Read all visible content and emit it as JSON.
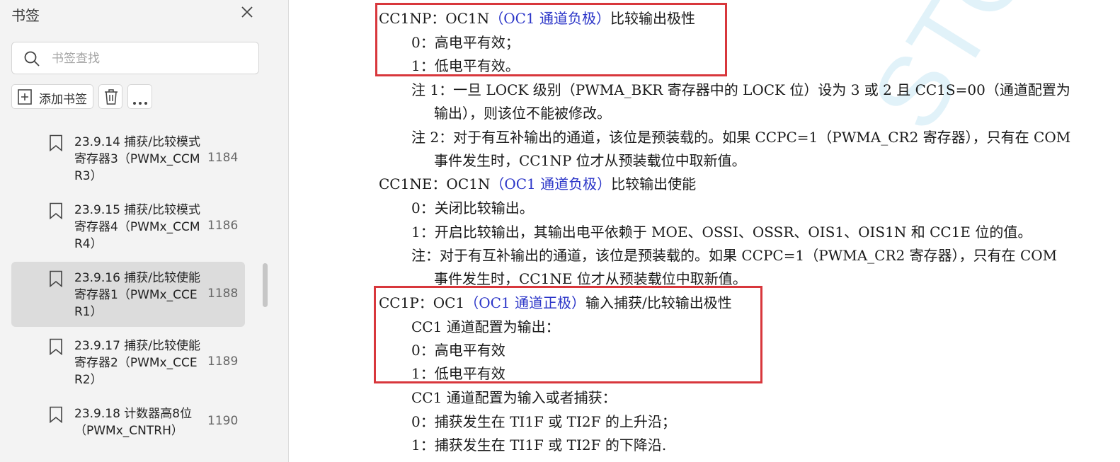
{
  "sidebar": {
    "title": "书签",
    "search_placeholder": "书签查找",
    "add_bookmark_label": "添加书签",
    "bookmarks": [
      {
        "title": "23.9.14 捕获/比较模式寄存器3（PWMx_CCMR3）",
        "page": "1184",
        "selected": false
      },
      {
        "title": "23.9.15 捕获/比较模式寄存器4（PWMx_CCMR4）",
        "page": "1186",
        "selected": false
      },
      {
        "title": "23.9.16 捕获/比较使能寄存器1（PWMx_CCER1）",
        "page": "1188",
        "selected": true
      },
      {
        "title": "23.9.17 捕获/比较使能寄存器2（PWMx_CCER2）",
        "page": "1189",
        "selected": false
      },
      {
        "title": "23.9.18 计数器高8位（PWMx_CNTRH）",
        "page": "1190",
        "selected": false
      }
    ]
  },
  "document": {
    "watermark": "STCMCU",
    "lines": [
      {
        "pre": "CC1NP：OC1N",
        "blue": "（OC1 通道负极）",
        "post": "比较输出极性"
      },
      {
        "text": "0：高电平有效；"
      },
      {
        "text": "1：低电平有效。"
      },
      {
        "text": "注 1：一旦 LOCK 级别（PWMA_BKR 寄存器中的 LOCK 位）设为 3 或 2 且 CC1S=00（通道配置为"
      },
      {
        "text": "输出），则该位不能被修改。"
      },
      {
        "text": "注 2：对于有互补输出的通道，该位是预装载的。如果 CCPC=1（PWMA_CR2 寄存器），只有在 COM"
      },
      {
        "text": "事件发生时，CC1NP 位才从预装载位中取新值。"
      },
      {
        "pre": "CC1NE：OC1N",
        "blue": "（OC1 通道负极）",
        "post": "比较输出使能"
      },
      {
        "text": "0：关闭比较输出。"
      },
      {
        "text": "1：开启比较输出，其输出电平依赖于 MOE、OSSI、OSSR、OIS1、OIS1N 和 CC1E 位的值。"
      },
      {
        "text": "注：对于有互补输出的通道，该位是预装载的。如果 CCPC=1（PWMA_CR2 寄存器），只有在 COM"
      },
      {
        "text": "事件发生时，CC1NE 位才从预装载位中取新值。"
      },
      {
        "pre": "CC1P：OC1",
        "blue": "（OC1 通道正极）",
        "post": "输入捕获/比较输出极性"
      },
      {
        "text": "CC1 通道配置为输出："
      },
      {
        "text": "0：高电平有效"
      },
      {
        "text": "1：低电平有效"
      },
      {
        "text": "CC1 通道配置为输入或者捕获："
      },
      {
        "text": "0：捕获发生在 TI1F 或 TI2F 的上升沿；"
      },
      {
        "text": "1：捕获发生在 TI1F 或 TI2F 的下降沿."
      }
    ]
  },
  "colors": {
    "highlight_box": "#d8373c",
    "link_blue": "#2b35c8",
    "selected_bg": "#dcdcdc"
  }
}
